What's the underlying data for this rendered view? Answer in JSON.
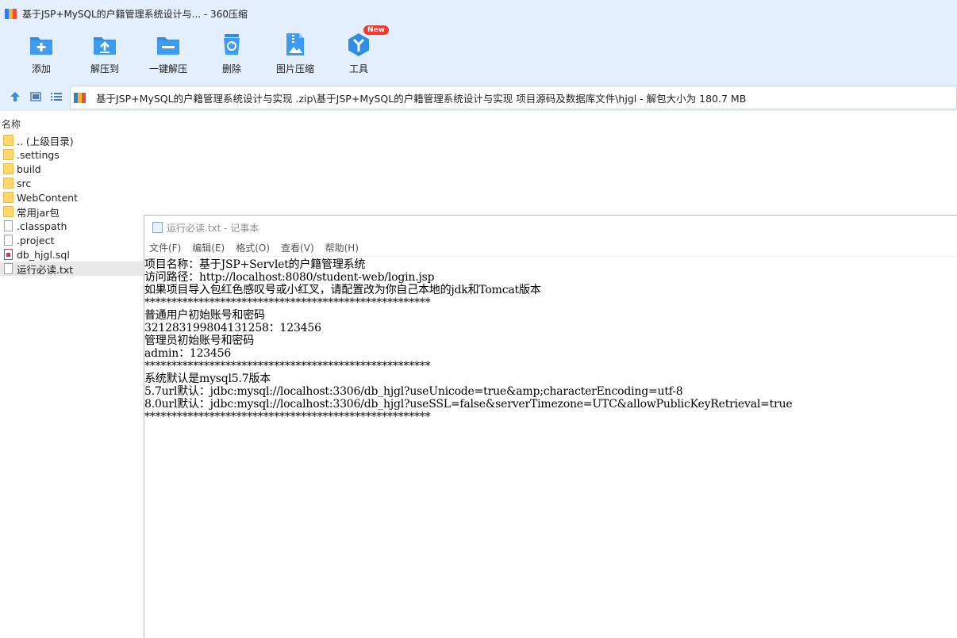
{
  "titlebar": {
    "title": "基于JSP+MySQL的户籍管理系统设计与... - 360压缩"
  },
  "toolbar": {
    "items": [
      {
        "label": "添加",
        "icon": "add-icon"
      },
      {
        "label": "解压到",
        "icon": "extract-to-icon"
      },
      {
        "label": "一键解压",
        "icon": "one-click-extract-icon"
      },
      {
        "label": "删除",
        "icon": "delete-icon"
      },
      {
        "label": "图片压缩",
        "icon": "image-compress-icon"
      },
      {
        "label": "工具",
        "icon": "tools-icon",
        "badge": "New"
      }
    ]
  },
  "address": {
    "path": "基于JSP+MySQL的户籍管理系统设计与实现 .zip\\基于JSP+MySQL的户籍管理系统设计与实现 项目源码及数据库文件\\hjgl - 解包大小为 180.7 MB"
  },
  "file_list": {
    "header": "名称",
    "items": [
      {
        "name": ".. (上级目录)",
        "type": "folder"
      },
      {
        "name": ".settings",
        "type": "folder"
      },
      {
        "name": "build",
        "type": "folder"
      },
      {
        "name": "src",
        "type": "folder"
      },
      {
        "name": "WebContent",
        "type": "folder"
      },
      {
        "name": "常用jar包",
        "type": "folder"
      },
      {
        "name": ".classpath",
        "type": "file"
      },
      {
        "name": ".project",
        "type": "file"
      },
      {
        "name": "db_hjgl.sql",
        "type": "sql"
      },
      {
        "name": "运行必读.txt",
        "type": "file",
        "selected": true
      }
    ]
  },
  "notepad": {
    "title": "运行必读.txt - 记事本",
    "menu": [
      "文件(F)",
      "编辑(E)",
      "格式(O)",
      "查看(V)",
      "帮助(H)"
    ],
    "lines": [
      "项目名称：基于JSP+Servlet的户籍管理系统",
      "访问路径：http://localhost:8080/student-web/login.jsp",
      "如果项目导入包红色感叹号或小红叉，请配置改为你自己本地的jdk和Tomcat版本",
      "*****************************************************",
      "普通用户初始账号和密码",
      "321283199804131258：123456",
      "管理员初始账号和密码",
      "admin：123456",
      "*****************************************************",
      "系统默认是mysql5.7版本",
      "5.7url默认：jdbc:mysql://localhost:3306/db_hjgl?useUnicode=true&amp;characterEncoding=utf-8",
      "8.0url默认：jdbc:mysql://localhost:3306/db_hjgl?useSSL=false&serverTimezone=UTC&allowPublicKeyRetrieval=true",
      "*****************************************************"
    ]
  },
  "colors": {
    "chrome_bg": "#e3effc",
    "accent": "#2f8de4",
    "badge": "#ef3b2d"
  }
}
